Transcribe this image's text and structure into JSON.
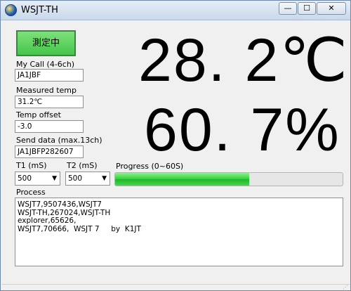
{
  "window": {
    "title": "WSJT-TH"
  },
  "titlebar_buttons": {
    "minimize": "—",
    "maximize": "☐",
    "close": "✕"
  },
  "measure_button": {
    "label": "測定中",
    "color": "#44c64a"
  },
  "fields": {
    "my_call": {
      "label": "My Call (4-6ch)",
      "value": "JA1JBF"
    },
    "measured_temp": {
      "label": "Measured temp",
      "value": "31.2℃"
    },
    "temp_offset": {
      "label": "Temp offset",
      "value": "-3.0"
    },
    "send_data": {
      "label": "Send data (max.13ch)",
      "value": "JA1JBFP282607"
    }
  },
  "readouts": {
    "temperature": "28. 2℃",
    "humidity": "60. 7%"
  },
  "t1": {
    "label": "T1 (mS)",
    "value": "500"
  },
  "t2": {
    "label": "T2 (mS)",
    "value": "500"
  },
  "progress": {
    "label": "Progress (0~60S)",
    "fraction": 0.59
  },
  "process": {
    "label": "Process",
    "lines": [
      "WSJT7,9507436,WSJT7",
      "WSJT-TH,267024,WSJT-TH",
      "explorer,65626,",
      "WSJT7,70666,  WSJT 7     by  K1JT"
    ]
  }
}
